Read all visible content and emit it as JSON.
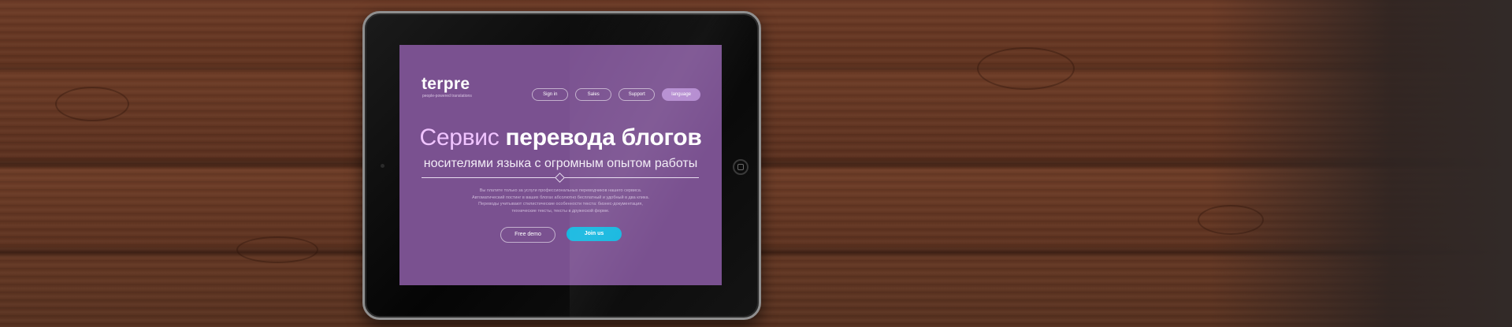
{
  "site": {
    "logo": "terpre",
    "tagline": "people-powered translations",
    "nav": [
      {
        "label": "Sign in"
      },
      {
        "label": "Sales"
      },
      {
        "label": "Support"
      },
      {
        "label": "language"
      }
    ],
    "hero": {
      "title_light": "Сервис",
      "title_bold": "перевода блогов",
      "subtitle": "носителями языка с огромным опытом работы",
      "description": [
        "Вы платите только за услуги профессиональных переводчиков нашего сервиса.",
        "Автоматический постинг в ваших блогах абсолютно бесплатный и удобный в два клика.",
        "Переводы учитывают стилистические особенности текста: бизнес-документация,",
        "технические тексты, тексты в дружеской форме."
      ]
    },
    "buttons": {
      "demo": "Free demo",
      "join": "Join us"
    }
  },
  "colors": {
    "screen_bg": "#7a5190",
    "accent": "#16b8e0",
    "nav_active": "#b48bd0"
  }
}
